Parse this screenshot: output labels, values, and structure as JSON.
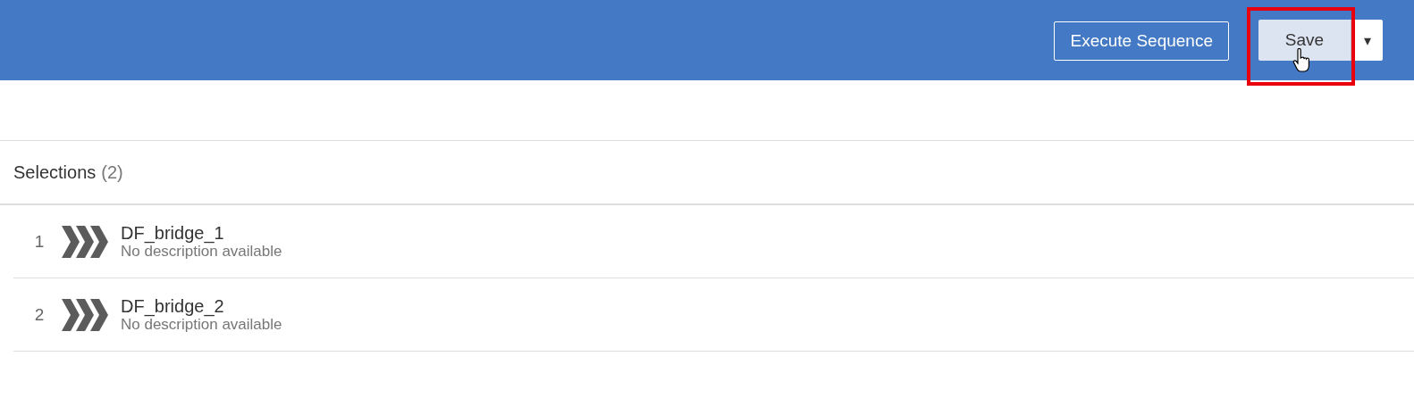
{
  "header": {
    "buttons": [
      {
        "kind": "outline",
        "label": "Execute Sequence"
      },
      {
        "kind": "split",
        "label": "Save",
        "menu": "▾"
      }
    ]
  },
  "selections": {
    "title": "Selections",
    "count": "(2)",
    "items": [
      {
        "index": "1",
        "name": "DF_bridge_1",
        "description": "No description available"
      },
      {
        "index": "2",
        "name": "DF_bridge_2",
        "description": "No description available"
      }
    ]
  }
}
